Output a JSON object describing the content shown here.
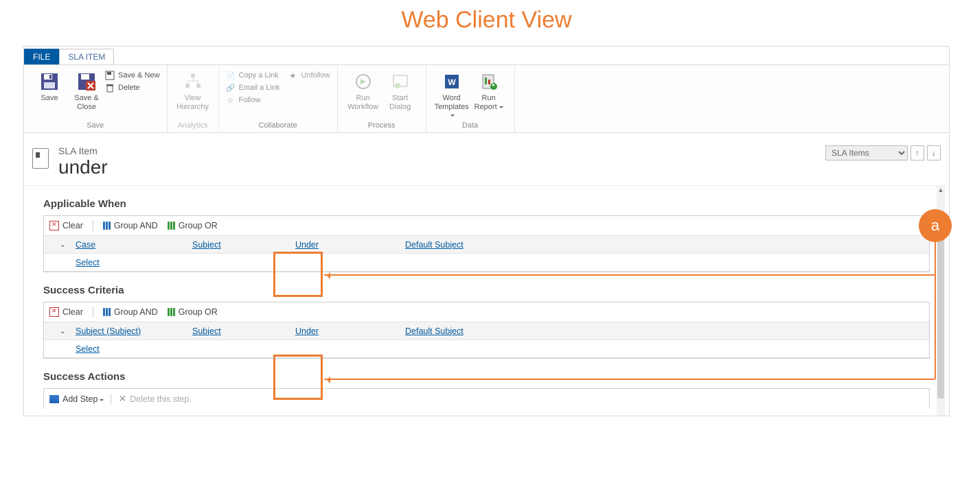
{
  "title_banner": "Web Client View",
  "tabs": {
    "file": "FILE",
    "entity": "SLA ITEM"
  },
  "ribbon": {
    "save_group": "Save",
    "save": "Save",
    "save_close": "Save & Close",
    "save_new": "Save & New",
    "delete": "Delete",
    "analytics_group": "Analytics",
    "view_hierarchy": "View Hierarchy",
    "collab_group": "Collaborate",
    "copy_link": "Copy a Link",
    "email_link": "Email a Link",
    "follow": "Follow",
    "unfollow": "Unfollow",
    "process_group": "Process",
    "run_workflow": "Run Workflow",
    "start_dialog": "Start Dialog",
    "data_group": "Data",
    "word_templates": "Word Templates",
    "run_report": "Run Report"
  },
  "record": {
    "entity": "SLA Item",
    "name": "under",
    "nav_option": "SLA Items"
  },
  "sections": {
    "applicable_when": "Applicable When",
    "success_criteria": "Success Criteria",
    "success_actions": "Success Actions"
  },
  "toolbar_labels": {
    "clear": "Clear",
    "group_and": "Group AND",
    "group_or": "Group OR"
  },
  "applicable": {
    "entity": "Case",
    "attribute": "Subject",
    "operator": "Under",
    "value": "Default Subject",
    "select": "Select"
  },
  "success": {
    "entity": "Subject (Subject)",
    "attribute": "Subject",
    "operator": "Under",
    "value": "Default Subject",
    "select": "Select"
  },
  "actions": {
    "add_step": "Add Step",
    "delete_step": "Delete this step."
  },
  "annotation": {
    "label": "a"
  }
}
